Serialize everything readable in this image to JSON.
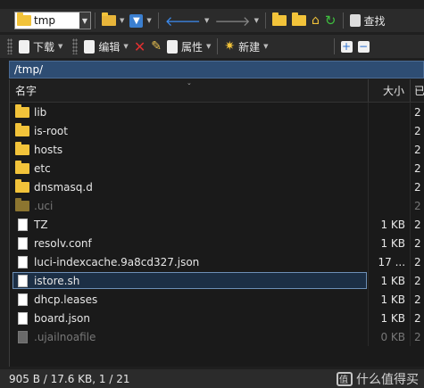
{
  "toolbar_top": {
    "path_combo": "tmp",
    "search_label": "查找"
  },
  "toolbar_file": {
    "download_label": "下载",
    "edit_label": "编辑",
    "properties_label": "属性",
    "new_label": "新建"
  },
  "path": "/tmp/",
  "columns": {
    "name": "名字",
    "size": "大小",
    "date": "已"
  },
  "files": [
    {
      "name": "lib",
      "type": "folder",
      "size": "",
      "date": "2",
      "hidden": false,
      "selected": false
    },
    {
      "name": "is-root",
      "type": "folder",
      "size": "",
      "date": "2",
      "hidden": false,
      "selected": false
    },
    {
      "name": "hosts",
      "type": "folder",
      "size": "",
      "date": "2",
      "hidden": false,
      "selected": false
    },
    {
      "name": "etc",
      "type": "folder",
      "size": "",
      "date": "2",
      "hidden": false,
      "selected": false
    },
    {
      "name": "dnsmasq.d",
      "type": "folder",
      "size": "",
      "date": "2",
      "hidden": false,
      "selected": false
    },
    {
      "name": ".uci",
      "type": "folder",
      "size": "",
      "date": "2",
      "hidden": true,
      "selected": false
    },
    {
      "name": "TZ",
      "type": "file",
      "size": "1 KB",
      "date": "2",
      "hidden": false,
      "selected": false
    },
    {
      "name": "resolv.conf",
      "type": "file",
      "size": "1 KB",
      "date": "2",
      "hidden": false,
      "selected": false
    },
    {
      "name": "luci-indexcache.9a8cd327.json",
      "type": "file",
      "size": "17 ...",
      "date": "2",
      "hidden": false,
      "selected": false
    },
    {
      "name": "istore.sh",
      "type": "file",
      "size": "1 KB",
      "date": "2",
      "hidden": false,
      "selected": true
    },
    {
      "name": "dhcp.leases",
      "type": "file",
      "size": "1 KB",
      "date": "2",
      "hidden": false,
      "selected": false
    },
    {
      "name": "board.json",
      "type": "file",
      "size": "1 KB",
      "date": "2",
      "hidden": false,
      "selected": false
    },
    {
      "name": ".ujailnoafile",
      "type": "file",
      "size": "0 KB",
      "date": "2",
      "hidden": true,
      "selected": false
    }
  ],
  "status": {
    "text": "905 B / 17.6 KB,   1 / 21",
    "watermark": "什么值得买"
  },
  "colors": {
    "folder": "#f2c33a",
    "path_bar": "#2e4d73",
    "selection_border": "#6d8fb5",
    "background": "#1a1a1a"
  }
}
